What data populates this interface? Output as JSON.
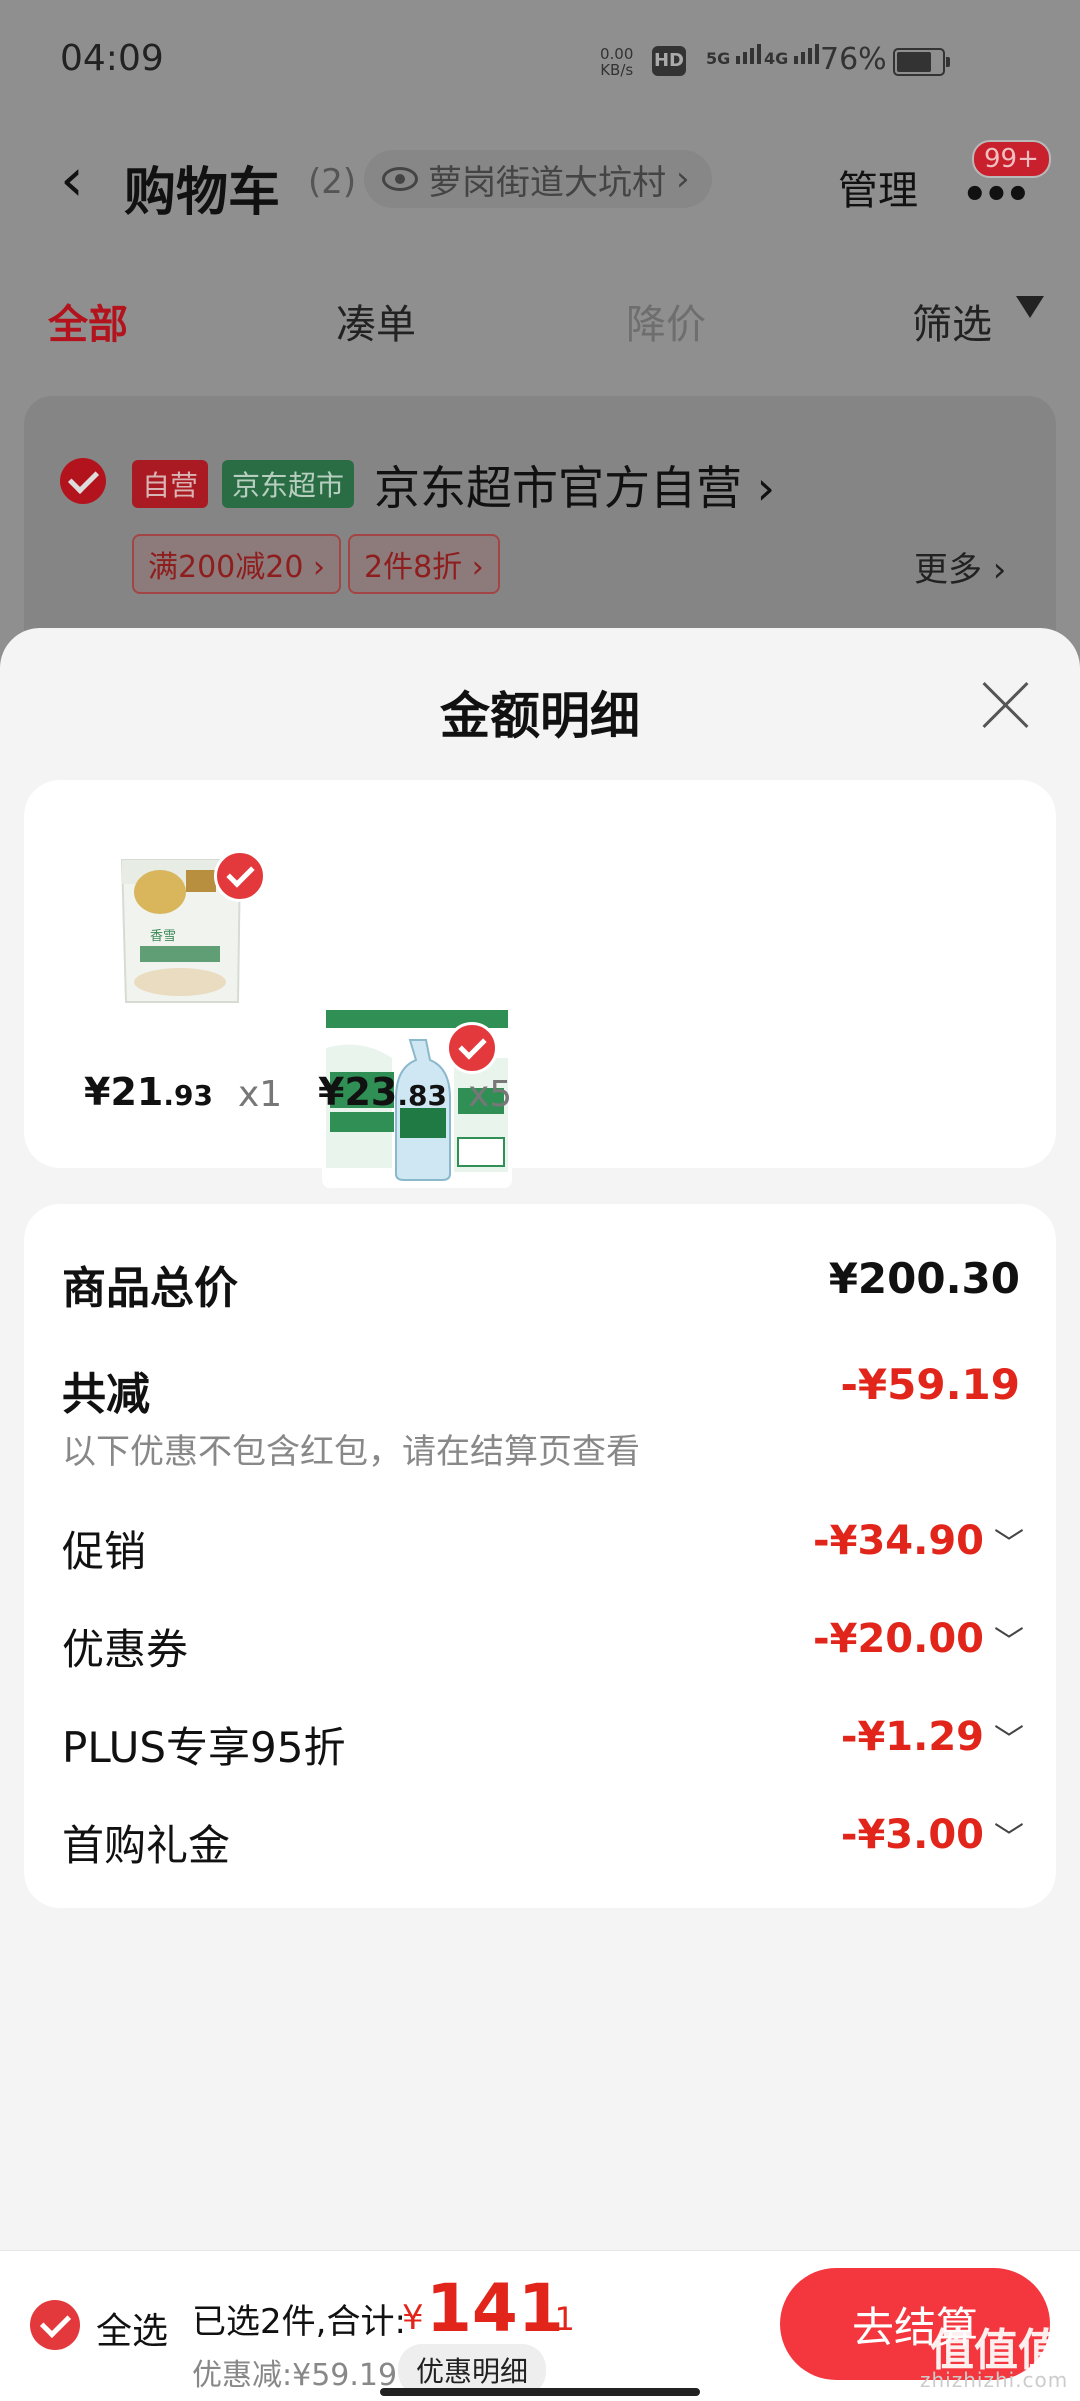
{
  "status": {
    "time": "04:09",
    "net_speed": "0.00",
    "net_unit": "KB/s",
    "hd": "HD",
    "sim1": "5G",
    "sim2": "4G",
    "battery": "76%"
  },
  "header": {
    "back_icon": "‹",
    "title": "购物车",
    "count": "(2)",
    "location": "萝岗街道大坑村",
    "location_chevron": "›",
    "manage": "管理",
    "badge": "99+"
  },
  "tabs": [
    {
      "label": "全部"
    },
    {
      "label": "凑单"
    },
    {
      "label": "降价"
    },
    {
      "label": "筛选"
    }
  ],
  "store": {
    "tag_self": "自营",
    "tag_jd": "京东超市",
    "name": "京东超市官方自营",
    "name_chevron": "›",
    "promos": [
      "满200减20 ›",
      "2件8折 ›"
    ],
    "more": "更多 ›"
  },
  "sheet": {
    "title": "金额明细",
    "items": [
      {
        "price_int": "¥21",
        "price_dec": ".93",
        "qty": "x1"
      },
      {
        "price_int": "¥23",
        "price_dec": ".83",
        "qty": "x5"
      }
    ],
    "total_label": "商品总价",
    "total_value": "¥200.30",
    "reduce_label": "共减",
    "reduce_value": "-¥59.19",
    "note": "以下优惠不包含红包，请在结算页查看",
    "discounts": [
      {
        "label": "促销",
        "value": "-¥34.90"
      },
      {
        "label": "优惠券",
        "value": "-¥20.00"
      },
      {
        "label": "PLUS专享95折",
        "value": "-¥1.29"
      },
      {
        "label": "首购礼金",
        "value": "-¥3.00"
      }
    ]
  },
  "bottom": {
    "select_all": "全选",
    "selected": "已选2件,合计:",
    "currency": "¥",
    "total_int": "141",
    "total_dec": ".11",
    "saved": "优惠减:¥59.19",
    "detail": "优惠明细",
    "checkout": "去结算"
  },
  "watermark": {
    "logo": "值值值",
    "site": "zhizhizhi.com"
  },
  "colors": {
    "accent": "#e1251b",
    "checkout": "#f4373e",
    "overlay": "#8f8f8f"
  }
}
